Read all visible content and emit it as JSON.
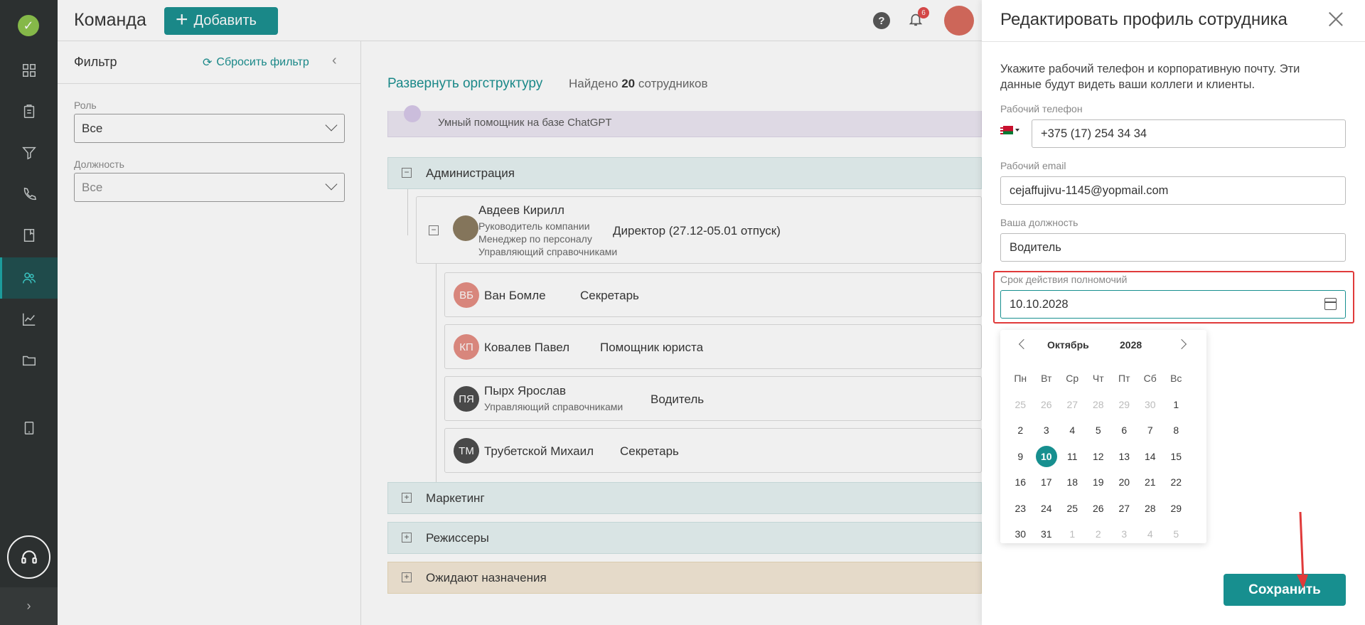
{
  "header": {
    "title": "Команда",
    "add_label": "Добавить",
    "notification_count": "6"
  },
  "sidebar": {
    "items": [
      "grid-icon",
      "clipboard-icon",
      "funnel-icon",
      "phone-icon",
      "book-icon",
      "team-icon",
      "chart-icon",
      "folder-icon",
      "tablet-icon"
    ],
    "active_item": "team-icon"
  },
  "filter": {
    "title": "Фильтр",
    "reset_label": "Сбросить фильтр",
    "role_label": "Роль",
    "role_value": "Все",
    "position_label": "Должность",
    "position_value": "Все"
  },
  "main": {
    "expand_label": "Развернуть оргструктуру",
    "found_prefix": "Найдено",
    "found_count": "20",
    "found_suffix": "сотрудников",
    "ai_text": "Умный помощник на базе ChatGPT",
    "groups": {
      "admin": "Администрация",
      "marketing": "Маркетинг",
      "directors": "Режиссеры",
      "pending": "Ожидают назначения"
    },
    "head": {
      "name": "Авдеев Кирилл",
      "role1": "Руководитель компании",
      "role2": "Менеджер по персоналу",
      "role3": "Управляющий справочниками",
      "position": "Директор (27.12-05.01 отпуск)"
    },
    "employees": [
      {
        "initials": "ВБ",
        "name": "Ван Бомле",
        "role": "",
        "position": "Секретарь",
        "color": "#e58c82"
      },
      {
        "initials": "КП",
        "name": "Ковалев Павел",
        "role": "",
        "position": "Помощник юриста",
        "color": "#e58c82"
      },
      {
        "initials": "ПЯ",
        "name": "Пырх Ярослав",
        "role": "Управляющий справочниками",
        "position": "Водитель",
        "color": "#4a4a4a"
      },
      {
        "initials": "ТМ",
        "name": "Трубетской Михаил",
        "role": "",
        "position": "Секретарь",
        "color": "#4a4a4a"
      }
    ]
  },
  "drawer": {
    "title": "Редактировать профиль сотрудника",
    "intro": "Укажите рабочий телефон и корпоративную почту. Эти данные будут видеть ваши коллеги и клиенты.",
    "phone_label": "Рабочий телефон",
    "phone_value": "+375 (17) 254 34 34",
    "email_label": "Рабочий email",
    "email_value": "cejaffujivu-1145@yopmail.com",
    "position_label": "Ваша должность",
    "position_value": "Водитель",
    "term_label": "Срок действия полномочий",
    "term_value": "10.10.2028",
    "save_label": "Сохранить"
  },
  "calendar": {
    "month": "Октябрь",
    "year": "2028",
    "weekdays": [
      "Пн",
      "Вт",
      "Ср",
      "Чт",
      "Пт",
      "Сб",
      "Вс"
    ],
    "days": [
      [
        "25",
        "26",
        "27",
        "28",
        "29",
        "30",
        "1"
      ],
      [
        "2",
        "3",
        "4",
        "5",
        "6",
        "7",
        "8"
      ],
      [
        "9",
        "10",
        "11",
        "12",
        "13",
        "14",
        "15"
      ],
      [
        "16",
        "17",
        "18",
        "19",
        "20",
        "21",
        "22"
      ],
      [
        "23",
        "24",
        "25",
        "26",
        "27",
        "28",
        "29"
      ],
      [
        "30",
        "31",
        "1",
        "2",
        "3",
        "4",
        "5"
      ]
    ],
    "selected_day": "10"
  },
  "colors": {
    "accent": "#178f8f",
    "highlight": "#e03a3a",
    "sidebar_bg": "#2b2f2f"
  }
}
